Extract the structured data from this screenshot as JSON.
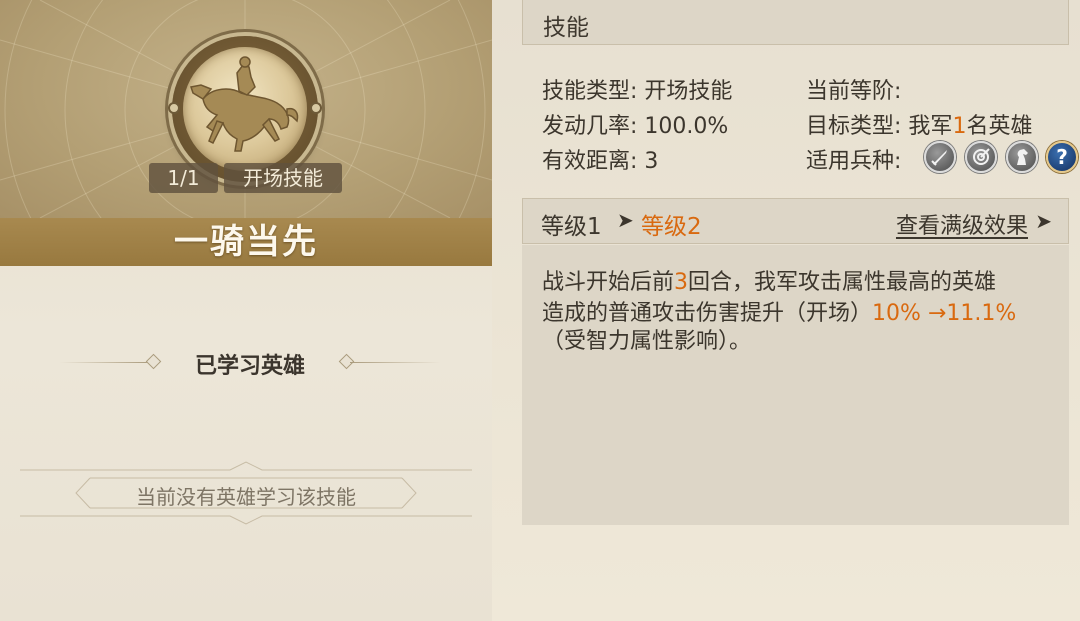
{
  "skill": {
    "name": "一骑当先",
    "level_badge": "1/1",
    "type_badge": "开场技能",
    "icon": "horseman-charge-icon"
  },
  "learned": {
    "title": "已学习英雄",
    "empty_text": "当前没有英雄学习该技能"
  },
  "panel": {
    "header": "技能",
    "info": {
      "type_label": "技能类型:",
      "type_value": "开场技能",
      "rate_label": "发动几率:",
      "rate_value": "100.0%",
      "range_label": "有效距离:",
      "range_value": "3",
      "rank_label": "当前等阶:",
      "rank_value": "",
      "target_label": "目标类型:",
      "target_pre": "我军",
      "target_num": "1",
      "target_post": "名英雄",
      "troop_label": "适用兵种:"
    },
    "troops": [
      {
        "name": "sword-troop-icon"
      },
      {
        "name": "bow-troop-icon"
      },
      {
        "name": "cavalry-troop-icon"
      },
      {
        "name": "unknown-troop-icon",
        "glyph": "?"
      }
    ],
    "levels": {
      "current": "等级1",
      "arrow": "➤",
      "next": "等级2",
      "full_link": "查看满级效果",
      "full_arrow": "➤"
    },
    "description": {
      "l1_a": "战斗开始后前",
      "l1_num": "3",
      "l1_b": "回合，我军攻击属性最高的英雄",
      "l2_a": "造成的普通攻击伤害提升（开场）",
      "l2_val": "10% →11.1%",
      "l3": "（受智力属性影响）。"
    }
  },
  "colors": {
    "highlight": "#d9690f",
    "title_bar": "#a8894f",
    "panel_bg": "#ddd6c7"
  }
}
